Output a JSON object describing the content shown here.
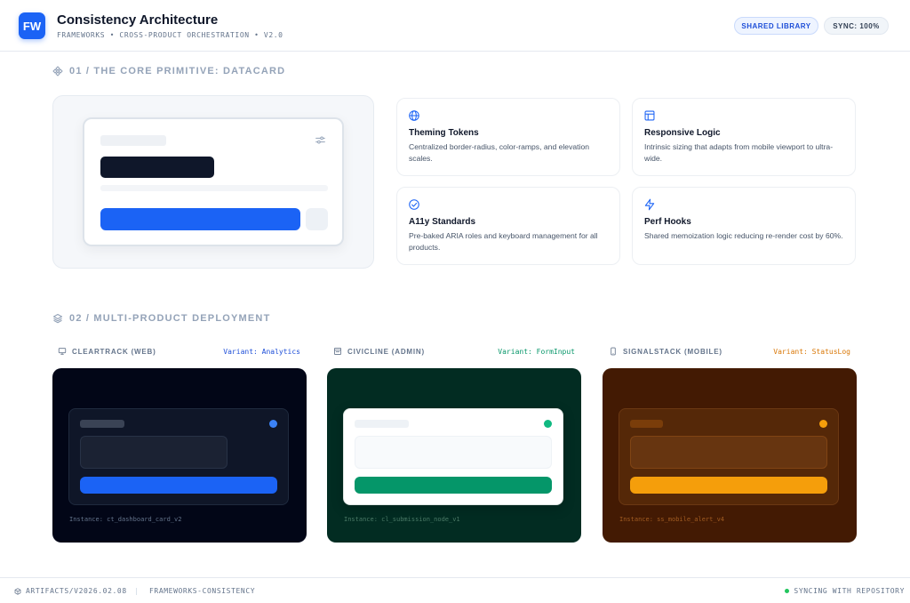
{
  "header": {
    "logo": "FW",
    "title": "Consistency Architecture",
    "subtitle": "FRAMEWORKS • CROSS-PRODUCT ORCHESTRATION • V2.0",
    "badge_library": "SHARED LIBRARY",
    "badge_sync": "SYNC: 100%"
  },
  "section1": {
    "heading": "01 / THE CORE PRIMITIVE: DATACARD",
    "features": [
      {
        "icon": "globe-icon",
        "title": "Theming Tokens",
        "desc": "Centralized border-radius, color-ramps, and elevation scales."
      },
      {
        "icon": "layout-icon",
        "title": "Responsive Logic",
        "desc": "Intrinsic sizing that adapts from mobile viewport to ultra-wide."
      },
      {
        "icon": "check-circle-icon",
        "title": "A11y Standards",
        "desc": "Pre-baked ARIA roles and keyboard management for all products."
      },
      {
        "icon": "lightning-icon",
        "title": "Perf Hooks",
        "desc": "Shared memoization logic reducing re-render cost by 60%."
      }
    ]
  },
  "section2": {
    "heading": "02 / MULTI-PRODUCT DEPLOYMENT",
    "products": [
      {
        "name": "CLEARTRACK (WEB)",
        "icon": "monitor-icon",
        "variant": "Variant: Analytics",
        "instance": "Instance: ct_dashboard_card_v2",
        "accent": "#1b63f5",
        "bg": "#020617"
      },
      {
        "name": "CIVICLINE (ADMIN)",
        "icon": "admin-panel-icon",
        "variant": "Variant: FormInput",
        "instance": "Instance: cl_submission_node_v1",
        "accent": "#059669",
        "bg": "#022c22"
      },
      {
        "name": "SIGNALSTACK (MOBILE)",
        "icon": "mobile-icon",
        "variant": "Variant: StatusLog",
        "instance": "Instance: ss_mobile_alert_v4",
        "accent": "#f59e0b",
        "bg": "#431a03"
      }
    ]
  },
  "footer": {
    "artifact": "ARTIFACTS/V2026.02.08",
    "separator": "|",
    "repo": "FRAMEWORKS-CONSISTENCY",
    "status": "SYNCING WITH REPOSITORY"
  }
}
